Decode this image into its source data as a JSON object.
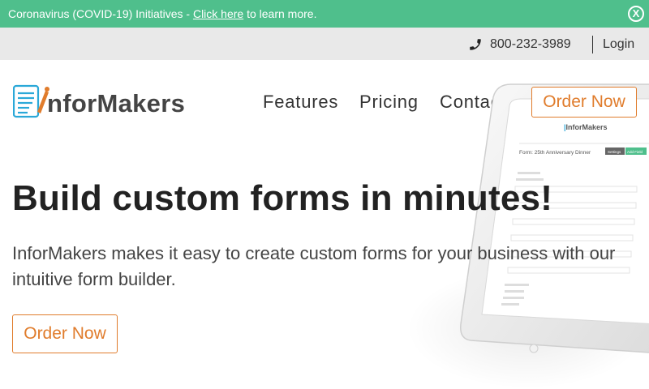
{
  "covid_banner": {
    "text_before": "Coronavirus (COVID-19) Initiatives - ",
    "link_text": "Click here",
    "text_after": " to learn more.",
    "close_label": "X"
  },
  "util_bar": {
    "phone": "800-232-3989",
    "login": "Login"
  },
  "header": {
    "logo_text": "nforMakers",
    "nav": {
      "features": "Features",
      "pricing": "Pricing",
      "contact": "Contact"
    },
    "order_button": "Order Now"
  },
  "hero": {
    "title": "Build custom forms in minutes!",
    "description": "InforMakers makes it easy to create custom forms for your business with our intuitive form builder.",
    "order_button": "Order Now"
  },
  "tablet_preview": {
    "logo": "InforMakers",
    "form_title": "Form: 25th Anniversary Dinner",
    "settings_label": "Settings",
    "add_field_label": "Add Field"
  },
  "colors": {
    "banner_green": "#4fbf8c",
    "accent_orange": "#e07c2c",
    "util_gray": "#e9e9e9",
    "logo_blue": "#2aa8d8"
  }
}
